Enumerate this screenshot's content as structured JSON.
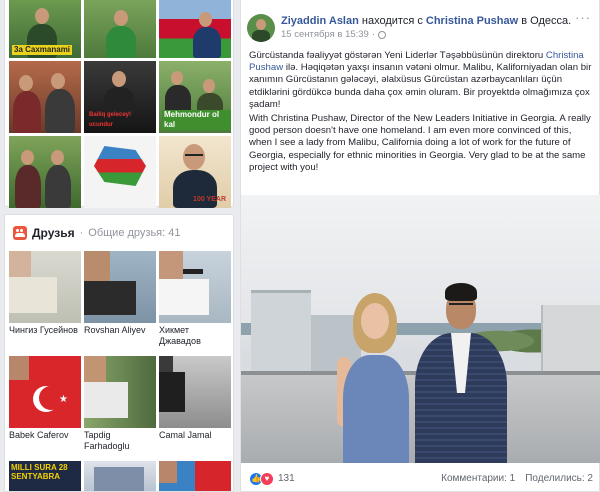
{
  "photos": {
    "captions": {
      "p0": "3a Caxmanami",
      "p4": "Bailiq gelecey! ucundur",
      "p5": "Mehmondur ol kal",
      "p8": "100 YEAR"
    }
  },
  "friends": {
    "title": "Друзья",
    "separator": "·",
    "mutual": "Общие друзья: 41",
    "list": [
      {
        "name": "Чингиз Гусейнов"
      },
      {
        "name": "Rovshan Aliyev"
      },
      {
        "name": "Хикмет Джавадов"
      },
      {
        "name": "Babek Caferov"
      },
      {
        "name": "Tapdig Farhadoglu"
      },
      {
        "name": "Camal Jamal"
      },
      {
        "name": ""
      },
      {
        "name": ""
      },
      {
        "name": ""
      }
    ],
    "milli_caption": "MILLI SURA 28 SENTYABRA"
  },
  "post": {
    "author": "Ziyaddin Aslan",
    "action": "находится с",
    "tagged": "Christina Pushaw",
    "location": "в Одесса.",
    "time": "15 сентября в 15:39",
    "menu": "···",
    "text_az_1": "Gürcüstanda fəaliyyət göstərən Yeni Liderlər Təşəbbüsünün direktoru",
    "text_az_link": "Christina Pushaw",
    "text_az_2": "ilə. Həqiqətən yaxşı insanın vətəni olmur. Malibu, Kaliforniyadan olan bir xanımın Gürcüstanın gələcəyi, əlalxüsus Gürcüstan azərbaycanlıları üçün etdiklərini gördükcə bunda daha çox əmin oluram. Bir proyektdə olmağımıza çox şadam!",
    "text_en": "With Christina Pushaw, Director of the New Leaders Initiative in Georgia. A really good person doesn't have one homeland. I am even more convinced of this, when I see a lady from Malibu, California doing a lot of work for the future of Georgia, especially for ethnic minorities in Georgia. Very glad to be at the same project with you!",
    "reaction_count": "131",
    "comments": "Комментарии: 1",
    "shares": "Поделились: 2"
  }
}
